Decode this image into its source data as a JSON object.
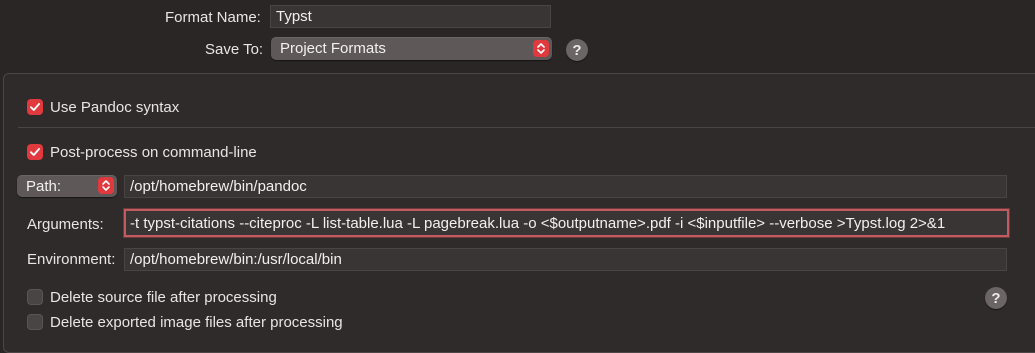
{
  "header": {
    "format_name_label": "Format Name:",
    "format_name_value": "Typst",
    "save_to_label": "Save To:",
    "save_to_value": "Project Formats",
    "help_glyph": "?"
  },
  "options": {
    "use_pandoc_label": "Use Pandoc syntax",
    "use_pandoc_checked": true,
    "post_process_label": "Post-process on command-line",
    "post_process_checked": true,
    "path_select_value": "Path:",
    "path_value": "/opt/homebrew/bin/pandoc",
    "arguments_label": "Arguments:",
    "arguments_value": "-t typst-citations --citeproc -L list-table.lua -L pagebreak.lua -o <$outputname>.pdf -i <$inputfile> --verbose  >Typst.log 2>&1",
    "environment_label": "Environment:",
    "environment_value": "/opt/homebrew/bin:/usr/local/bin",
    "delete_source_label": "Delete source file after processing",
    "delete_source_checked": false,
    "delete_images_label": "Delete exported image files after processing",
    "delete_images_checked": false
  },
  "colors": {
    "accent": "#e0393e",
    "background": "#2a2626",
    "panel": "#302b2b",
    "field": "#3a3535"
  }
}
